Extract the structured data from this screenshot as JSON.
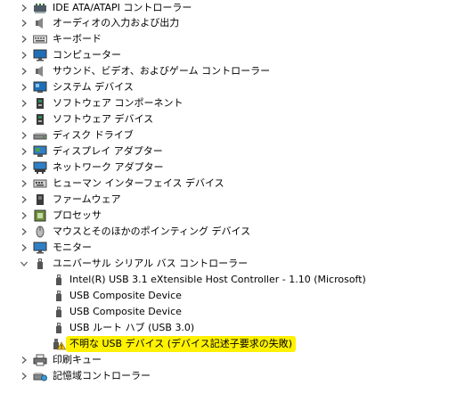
{
  "tree": {
    "rows": [
      {
        "label": "IDE ATA/ATAPI コントローラー",
        "icon": "ide-controller-icon"
      },
      {
        "label": "オーディオの入力および出力",
        "icon": "speaker-icon"
      },
      {
        "label": "キーボード",
        "icon": "keyboard-icon"
      },
      {
        "label": "コンピューター",
        "icon": "computer-icon"
      },
      {
        "label": "サウンド、ビデオ、およびゲーム コントローラー",
        "icon": "speaker-icon"
      },
      {
        "label": "システム デバイス",
        "icon": "system-devices-icon"
      },
      {
        "label": "ソフトウェア コンポーネント",
        "icon": "software-component-icon"
      },
      {
        "label": "ソフトウェア デバイス",
        "icon": "software-device-icon"
      },
      {
        "label": "ディスク ドライブ",
        "icon": "disk-drive-icon"
      },
      {
        "label": "ディスプレイ アダプター",
        "icon": "display-adapter-icon"
      },
      {
        "label": "ネットワーク アダプター",
        "icon": "network-adapter-icon"
      },
      {
        "label": "ヒューマン インターフェイス デバイス",
        "icon": "hid-icon"
      },
      {
        "label": "ファームウェア",
        "icon": "firmware-icon"
      },
      {
        "label": "プロセッサ",
        "icon": "processor-icon"
      },
      {
        "label": "マウスとそのほかのポインティング デバイス",
        "icon": "mouse-icon"
      },
      {
        "label": "モニター",
        "icon": "monitor-icon"
      },
      {
        "label": "ユニバーサル シリアル バス コントローラー",
        "icon": "usb-icon",
        "expanded": true
      },
      {
        "label": "Intel(R) USB 3.1 eXtensible Host Controller - 1.10 (Microsoft)",
        "icon": "usb-icon",
        "child": true
      },
      {
        "label": "USB Composite Device",
        "icon": "usb-icon",
        "child": true
      },
      {
        "label": "USB Composite Device",
        "icon": "usb-icon",
        "child": true
      },
      {
        "label": "USB ルート ハブ (USB 3.0)",
        "icon": "usb-icon",
        "child": true
      },
      {
        "label": "不明な USB デバイス (デバイス記述子要求の失敗)",
        "icon": "usb-warning-icon",
        "child": true,
        "highlighted": true
      },
      {
        "label": "印刷キュー",
        "icon": "printer-icon"
      },
      {
        "label": "記憶域コントローラー",
        "icon": "storage-controller-icon"
      }
    ]
  },
  "colors": {
    "highlight": "#fff200",
    "chevron": "#555555",
    "warning": "#f5c400"
  }
}
